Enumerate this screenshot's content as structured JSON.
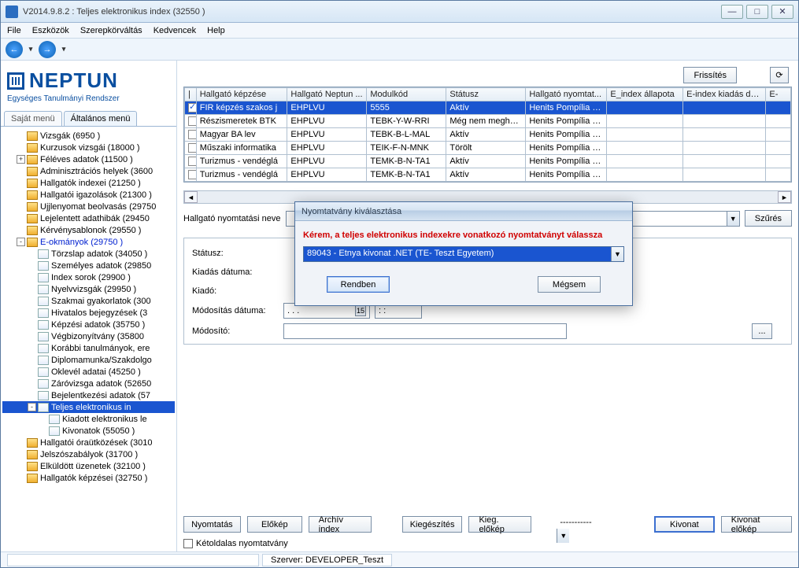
{
  "window": {
    "title": "V2014.9.8.2 : Teljes elektronikus index (32550  )"
  },
  "menu": {
    "file": "File",
    "tools": "Eszközök",
    "roleswitch": "Szerepkörváltás",
    "favorites": "Kedvencek",
    "help": "Help"
  },
  "logo": {
    "brand": "NEPTUN",
    "subtitle": "Egységes Tanulmányi Rendszer"
  },
  "left_tabs": {
    "own": "Saját menü",
    "general": "Általános menü"
  },
  "tree": [
    {
      "depth": 1,
      "exp": "",
      "icon": "f",
      "label": "Vizsgák (6950  )"
    },
    {
      "depth": 1,
      "exp": "",
      "icon": "f",
      "label": "Kurzusok vizsgái (18000  )"
    },
    {
      "depth": 1,
      "exp": "+",
      "icon": "f",
      "label": "Féléves adatok (11500  )"
    },
    {
      "depth": 1,
      "exp": "",
      "icon": "f",
      "label": "Adminisztrációs helyek (3600"
    },
    {
      "depth": 1,
      "exp": "",
      "icon": "f",
      "label": "Hallgatók indexei (21250  )"
    },
    {
      "depth": 1,
      "exp": "",
      "icon": "f",
      "label": "Hallgatói igazolások (21300  )"
    },
    {
      "depth": 1,
      "exp": "",
      "icon": "f",
      "label": "Ujjlenyomat beolvasás (29750"
    },
    {
      "depth": 1,
      "exp": "",
      "icon": "f",
      "label": "Lejelentett adathibák (29450"
    },
    {
      "depth": 1,
      "exp": "",
      "icon": "f",
      "label": "Kérvénysablonok (29550  )"
    },
    {
      "depth": 1,
      "exp": "-",
      "icon": "f",
      "label": "E-okmányok (29750  )",
      "blue": true
    },
    {
      "depth": 2,
      "exp": "",
      "icon": "d",
      "label": "Törzslap adatok (34050  )"
    },
    {
      "depth": 2,
      "exp": "",
      "icon": "d",
      "label": "Személyes adatok (29850"
    },
    {
      "depth": 2,
      "exp": "",
      "icon": "d",
      "label": "Index sorok (29900  )"
    },
    {
      "depth": 2,
      "exp": "",
      "icon": "d",
      "label": "Nyelvvizsgák (29950  )"
    },
    {
      "depth": 2,
      "exp": "",
      "icon": "d",
      "label": "Szakmai gyakorlatok (300"
    },
    {
      "depth": 2,
      "exp": "",
      "icon": "d",
      "label": "Hivatalos bejegyzések (3"
    },
    {
      "depth": 2,
      "exp": "",
      "icon": "d",
      "label": "Képzési adatok (35750  )"
    },
    {
      "depth": 2,
      "exp": "",
      "icon": "d",
      "label": "Végbizonyítvány (35800"
    },
    {
      "depth": 2,
      "exp": "",
      "icon": "d",
      "label": "Korábbi tanulmányok, ere"
    },
    {
      "depth": 2,
      "exp": "",
      "icon": "d",
      "label": "Diplomamunka/Szakdolgo"
    },
    {
      "depth": 2,
      "exp": "",
      "icon": "d",
      "label": "Oklevél adatai (45250  )"
    },
    {
      "depth": 2,
      "exp": "",
      "icon": "d",
      "label": "Záróvizsga adatok (52650"
    },
    {
      "depth": 2,
      "exp": "",
      "icon": "d",
      "label": "Bejelentkezési adatok (57"
    },
    {
      "depth": 2,
      "exp": "-",
      "icon": "d",
      "label": "Teljes elektronikus in",
      "sel": true
    },
    {
      "depth": 3,
      "exp": "",
      "icon": "d",
      "label": "Kiadott elektronikus le"
    },
    {
      "depth": 3,
      "exp": "",
      "icon": "d",
      "label": "Kivonatok (55050  )"
    },
    {
      "depth": 1,
      "exp": "",
      "icon": "f",
      "label": "Hallgatói óraütközések (3010"
    },
    {
      "depth": 1,
      "exp": "",
      "icon": "f",
      "label": "Jelszószabályok (31700  )"
    },
    {
      "depth": 1,
      "exp": "",
      "icon": "f",
      "label": "Elküldött üzenetek (32100  )"
    },
    {
      "depth": 1,
      "exp": "",
      "icon": "f",
      "label": "Hallgatók képzései (32750  )"
    }
  ],
  "refresh_btn": "Frissítés",
  "table": {
    "headers": [
      "|",
      "Hallgató képzése",
      "Hallgató Neptun ...",
      "Modulkód",
      "Státusz",
      "Hallgató nyomtat...",
      "E_index állapota",
      "E-index kiadás dá...",
      "E- "
    ],
    "rows": [
      {
        "sel": true,
        "cells": [
          "FIR képzés szakos j",
          "EHPLVU",
          "5555",
          "Aktív",
          "Henits Pompília Dr.",
          "",
          "",
          ""
        ]
      },
      {
        "cells": [
          "Részismeretek BTK",
          "EHPLVU",
          "TEBK-Y-W-RRI",
          "Még nem meghatáro",
          "Henits Pompília Dr.",
          "",
          "",
          ""
        ]
      },
      {
        "cells": [
          "Magyar BA lev",
          "EHPLVU",
          "TEBK-B-L-MAL",
          "Aktív",
          "Henits Pompília Dr.",
          "",
          "",
          ""
        ]
      },
      {
        "cells": [
          "Műszaki informatika",
          "EHPLVU",
          "TEIK-F-N-MNK",
          "Törölt",
          "Henits Pompília Dr.",
          "",
          "",
          ""
        ]
      },
      {
        "cells": [
          "Turizmus - vendéglá",
          "EHPLVU",
          "TEMK-B-N-TA1",
          "Aktív",
          "Henits Pompília Dr.",
          "",
          "",
          ""
        ]
      },
      {
        "cells": [
          "Turizmus - vendéglá",
          "EHPLVU",
          "TEMK-B-N-TA1",
          "Aktív",
          "Henits Pompília Dr.",
          "",
          "",
          ""
        ]
      }
    ]
  },
  "filter": {
    "label": "Hallgató nyomtatási neve",
    "button": "Szűrés"
  },
  "group": {
    "status_label": "Státusz:",
    "kiadas_label": "Kiadás dátuma:",
    "kiado_label": "Kiadó:",
    "mod_datum_label": "Módosítás dátuma:",
    "mod_datum_val": " .  .  .",
    "mod_datum_cal": "15",
    "mod_time_val": " :  : ",
    "modosito_label": "Módosító:",
    "smallbtn": "..."
  },
  "bottom": {
    "print": "Nyomtatás",
    "preview": "Előkép",
    "archive": "Archív index",
    "supplement": "Kiegészítés",
    "supp_preview": "Kieg. előkép",
    "combo_val": "-----------",
    "extract": "Kivonat",
    "extract_preview": "Kivonat előkép",
    "twosided": "Kétoldalas nyomtatvány"
  },
  "status": {
    "server": "Szerver: DEVELOPER_Teszt"
  },
  "dialog": {
    "title": "Nyomtatvány kiválasztása",
    "warning": "Kérem, a teljes elektronikus indexekre vonatkozó nyomtatványt válassza",
    "selected": "89043 - Etnya kivonat .NET    (TE- Teszt Egyetem)",
    "ok": "Rendben",
    "cancel": "Mégsem"
  }
}
